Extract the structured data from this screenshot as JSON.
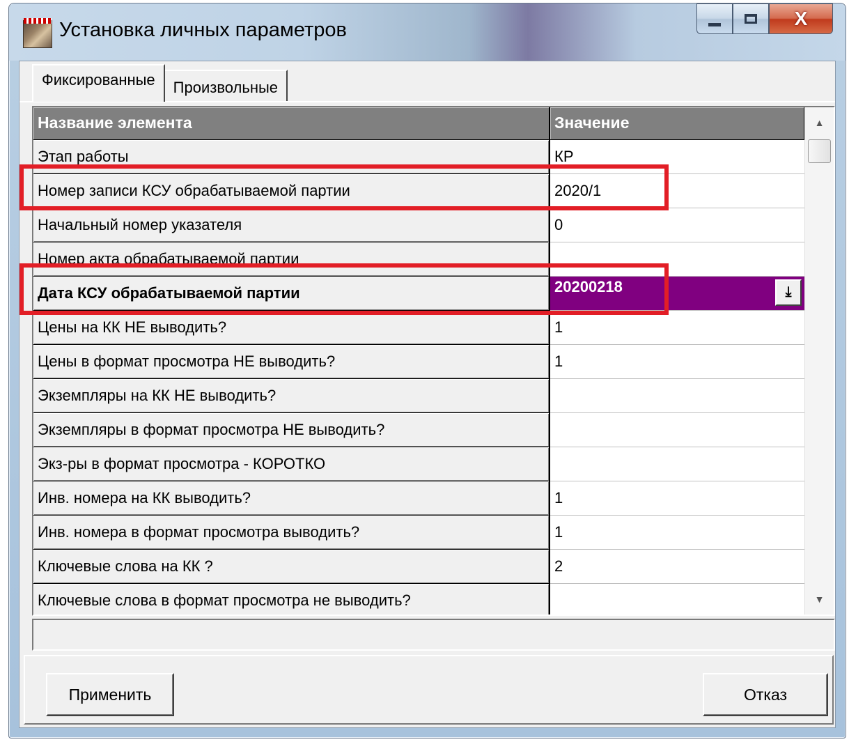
{
  "window": {
    "title": "Установка личных параметров",
    "caption": {
      "close_label": "X"
    }
  },
  "tabs": [
    {
      "label": "Фиксированные",
      "active": true
    },
    {
      "label": "Произвольные",
      "active": false
    }
  ],
  "grid": {
    "columns": [
      "Название элемента",
      "Значение"
    ],
    "rows": [
      {
        "name": "Этап работы",
        "value": "КР"
      },
      {
        "name": "Номер записи КСУ обрабатываемой партии",
        "value": "2020/1"
      },
      {
        "name": "Начальный номер указателя",
        "value": "0"
      },
      {
        "name": "Номер акта обрабатываемой партии",
        "value": ""
      },
      {
        "name": "Дата КСУ обрабатываемой партии",
        "value": "20200218",
        "selected": true
      },
      {
        "name": "Цены на КК НЕ выводить?",
        "value": "1"
      },
      {
        "name": "Цены в формат просмотра НЕ выводить?",
        "value": "1"
      },
      {
        "name": "Экземпляры на КК НЕ выводить?",
        "value": ""
      },
      {
        "name": "Экземпляры в формат просмотра НЕ выводить?",
        "value": ""
      },
      {
        "name": "Экз-ры в формат просмотра - КОРОТКО",
        "value": ""
      },
      {
        "name": "Инв. номера на КК выводить?",
        "value": "1"
      },
      {
        "name": "Инв. номера в формат просмотра выводить?",
        "value": "1"
      },
      {
        "name": "Ключевые слова на КК ?",
        "value": "2"
      },
      {
        "name": "Ключевые слова в формат просмотра не выводить?",
        "value": ""
      }
    ],
    "selected_color": "#800080",
    "dropdown_icon": "arrow-down-to-line-icon"
  },
  "status": {
    "text": ""
  },
  "buttons": {
    "apply": "Применить",
    "cancel": "Отказ"
  },
  "highlight_color": "#e21e26"
}
